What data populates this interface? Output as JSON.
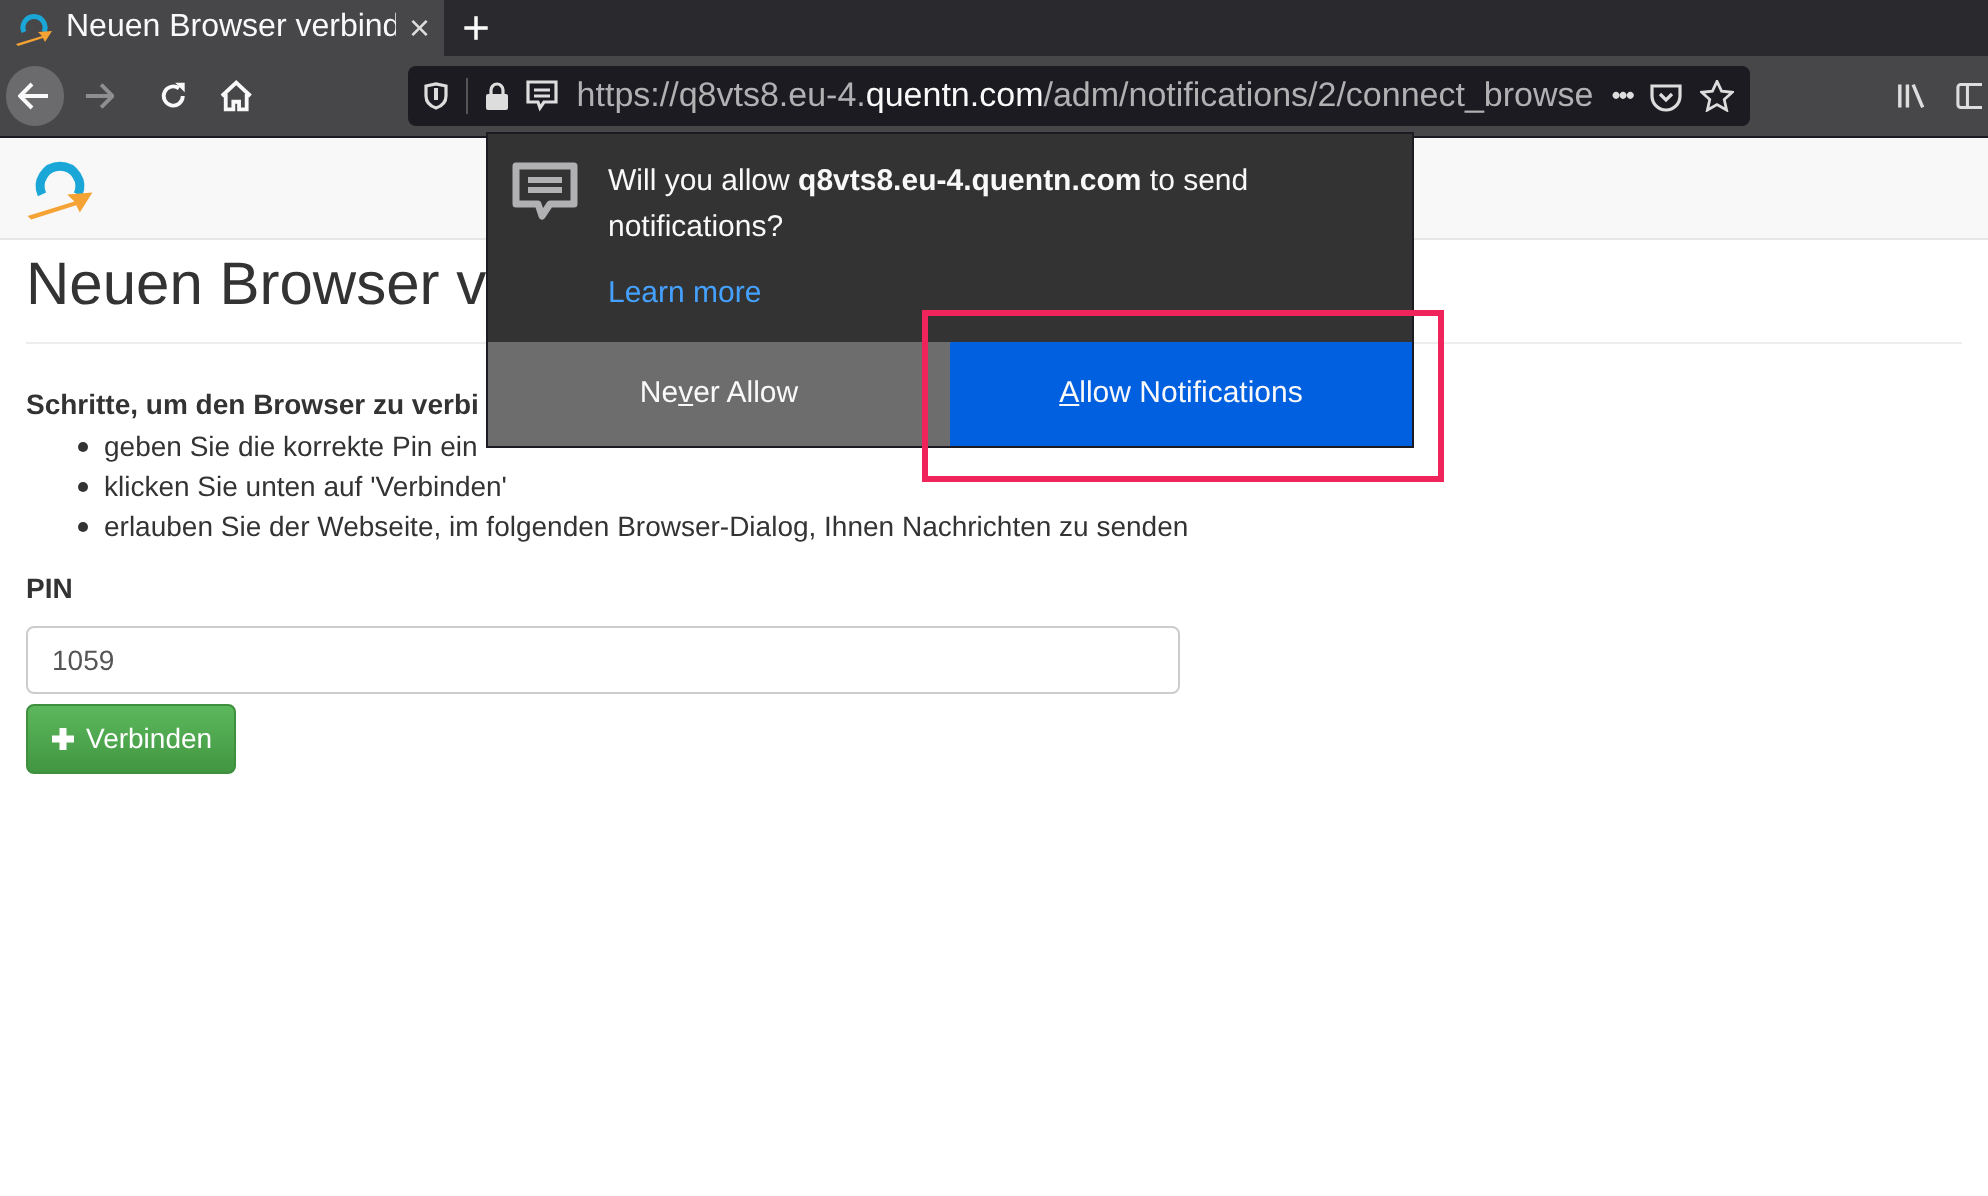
{
  "tab": {
    "title": "Neuen Browser verbind",
    "close": "×"
  },
  "new_tab": "+",
  "address_bar": {
    "url_start": "https://q8vts8.eu-4.",
    "url_domain": "quentn.com",
    "url_rest": "/adm/notifications/2/connect_browse",
    "more": "•••"
  },
  "page": {
    "heading": "Neuen Browser v",
    "steps_title": "Schritte, um den Browser zu verbi",
    "steps": [
      "geben Sie die korrekte Pin ein",
      "klicken Sie unten auf 'Verbinden'",
      "erlauben Sie der Webseite, im folgenden Browser-Dialog, Ihnen Nachrichten zu senden"
    ],
    "pin_label": "PIN",
    "pin_value": "1059",
    "connect_button": "Verbinden"
  },
  "permission_popup": {
    "message": "Will you allow **q8vts8.eu-4.quentn.com** to send notifications?",
    "learn_more": "Learn more",
    "buttons": [
      {
        "kind": "secondary",
        "before": "Ne",
        "key": "v",
        "after": "er Allow"
      },
      {
        "kind": "primary",
        "key": "A",
        "after": "llow Notifications"
      }
    ]
  }
}
